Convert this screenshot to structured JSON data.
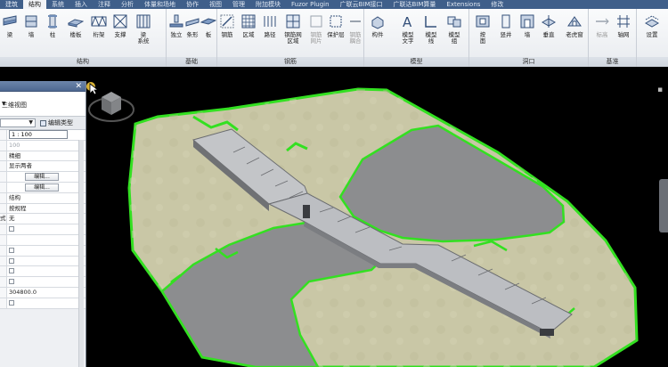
{
  "ribbon": {
    "tabs": [
      "建筑",
      "结构",
      "系统",
      "插入",
      "注释",
      "分析",
      "体量和场地",
      "协作",
      "视图",
      "管理",
      "附加模块",
      "Fuzor Plugin",
      "广联云BIM接口",
      "广联达BIM算量",
      "Extensions",
      "修改"
    ],
    "active_tab_index": 1,
    "groups": [
      {
        "title": "结构",
        "buttons": [
          {
            "label": "梁"
          },
          {
            "label": "墙"
          },
          {
            "label": "柱"
          },
          {
            "label": "楼板"
          },
          {
            "label": "桁架"
          },
          {
            "label": "支撑"
          },
          {
            "label": "梁",
            "label2": "系统"
          }
        ]
      },
      {
        "title": "基础",
        "buttons": [
          {
            "label": "独立"
          },
          {
            "label": "条形"
          },
          {
            "label": "板"
          }
        ]
      },
      {
        "title": "钢筋",
        "buttons": [
          {
            "label": "钢筋"
          },
          {
            "label": "区域"
          },
          {
            "label": "路径"
          },
          {
            "label": "钢筋网",
            "label2": "区域"
          },
          {
            "label": "钢筋",
            "label2": "网片"
          },
          {
            "label": "保护层"
          },
          {
            "label": "钢筋",
            "label2": "耦合"
          }
        ]
      },
      {
        "title": "模型",
        "buttons": [
          {
            "label": "构件"
          },
          {
            "label": "模型",
            "label2": "文字"
          },
          {
            "label": "模型",
            "label2": "线"
          },
          {
            "label": "模型",
            "label2": "组"
          }
        ]
      },
      {
        "title": "洞口",
        "buttons": [
          {
            "label": "按",
            "label2": "面"
          },
          {
            "label": "竖井"
          },
          {
            "label": "墙"
          },
          {
            "label": "垂直"
          },
          {
            "label": "老虎窗"
          }
        ]
      },
      {
        "title": "基准",
        "buttons": [
          {
            "label": "标高"
          },
          {
            "label": "轴网"
          }
        ]
      },
      {
        "title": "",
        "buttons": [
          {
            "label": "设置"
          }
        ]
      }
    ]
  },
  "properties": {
    "view_name": "三维视图",
    "type_selector": "",
    "edit_type_label": "编辑类型",
    "rows": [
      {
        "left": "",
        "value": "1 : 100",
        "kind": "input"
      },
      {
        "left": "",
        "value": "100",
        "kind": "grey"
      },
      {
        "left": "",
        "value": "精细",
        "kind": "text"
      },
      {
        "left": "",
        "value": "显示两者",
        "kind": "text"
      },
      {
        "left": "",
        "value": "编辑...",
        "kind": "button"
      },
      {
        "left": "",
        "value": "编辑...",
        "kind": "button"
      },
      {
        "left": "",
        "value": "结构",
        "kind": "text"
      },
      {
        "left": "",
        "value": "按规程",
        "kind": "text"
      },
      {
        "left": "式",
        "value": "无",
        "kind": "text"
      },
      {
        "left": "",
        "value": "",
        "kind": "check"
      },
      {
        "left": "",
        "value": "",
        "kind": "text"
      },
      {
        "left": "",
        "value": "",
        "kind": "check"
      },
      {
        "left": "",
        "value": "",
        "kind": "check"
      },
      {
        "left": "",
        "value": "",
        "kind": "check"
      },
      {
        "left": "",
        "value": "",
        "kind": "check"
      },
      {
        "left": "",
        "value": "304800.0",
        "kind": "text"
      },
      {
        "left": "",
        "value": "",
        "kind": "check"
      }
    ]
  },
  "colors": {
    "terrain": "#c9c7a6",
    "terrain_edge": "#33e021",
    "water": "#8c8d8f",
    "bridge_deck": "#bcbec2",
    "ribbon_tab_bg": "#3f5f8a"
  },
  "icons": {
    "viewcube": "viewcube-icon",
    "cursor": "cursor-icon",
    "close": "close-icon"
  }
}
